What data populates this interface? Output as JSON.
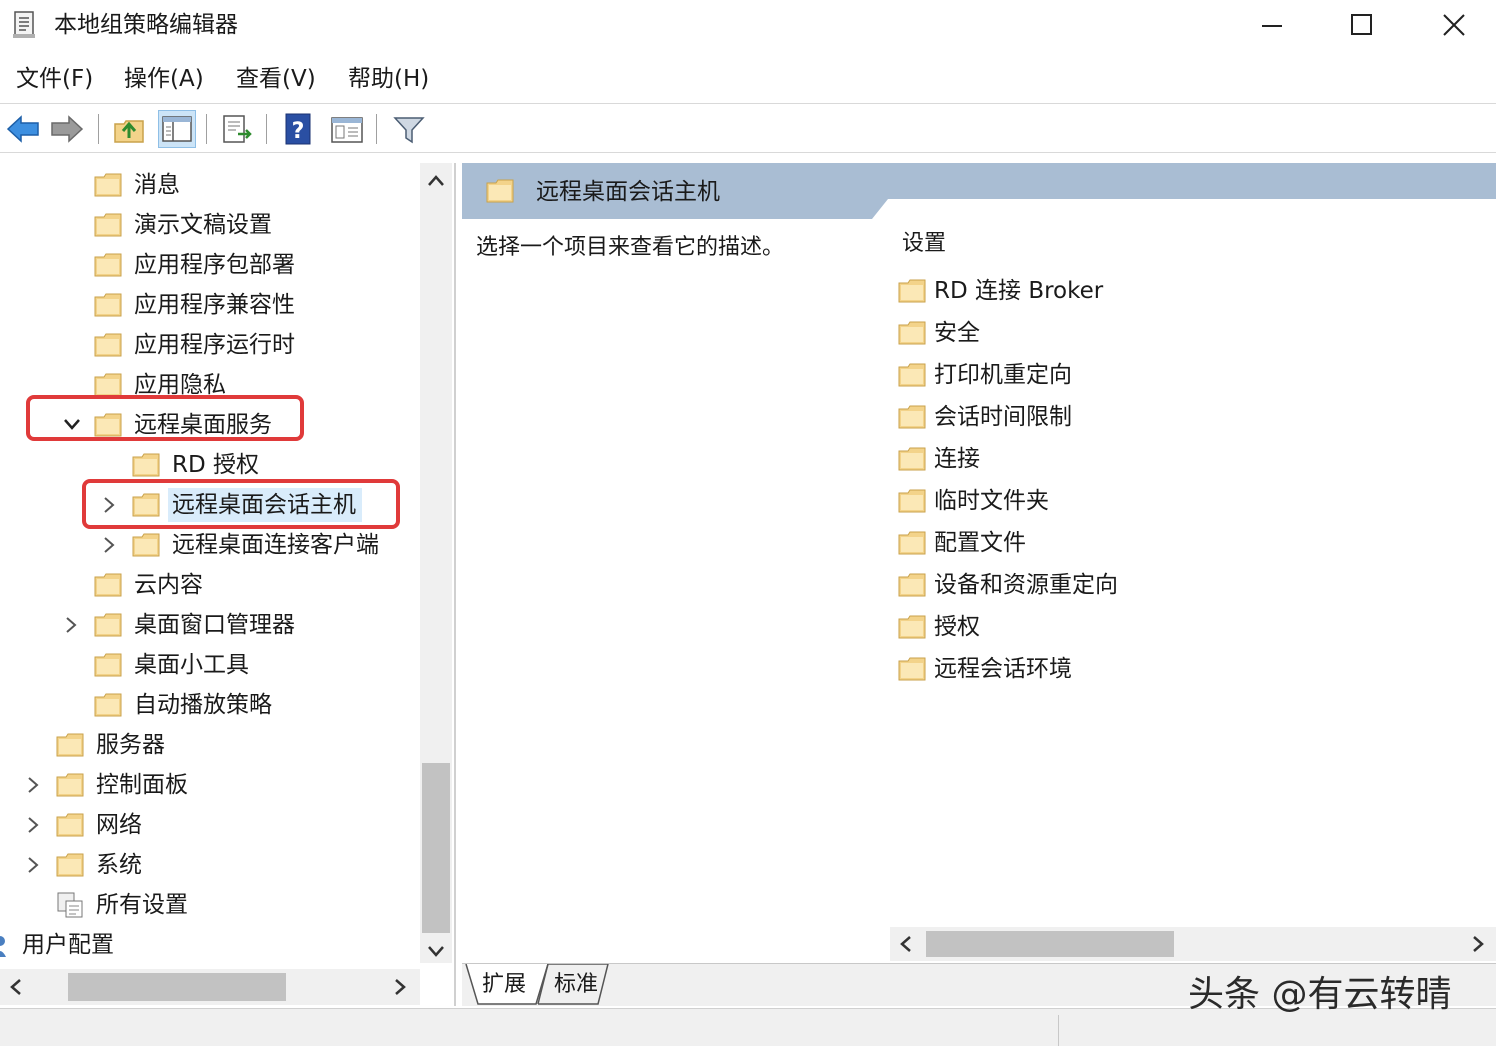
{
  "window": {
    "title": "本地组策略编辑器"
  },
  "menu": [
    "文件(F)",
    "操作(A)",
    "查看(V)",
    "帮助(H)"
  ],
  "colors": {
    "folder": "#f3d38a",
    "selection": "#d9ecfb",
    "highlight": "#e03a3a",
    "header": "#a9bdd3"
  },
  "tree": {
    "items": [
      {
        "label": "消息",
        "level": 2,
        "expander": "none"
      },
      {
        "label": "演示文稿设置",
        "level": 2,
        "expander": "none"
      },
      {
        "label": "应用程序包部署",
        "level": 2,
        "expander": "none"
      },
      {
        "label": "应用程序兼容性",
        "level": 2,
        "expander": "none"
      },
      {
        "label": "应用程序运行时",
        "level": 2,
        "expander": "none"
      },
      {
        "label": "应用隐私",
        "level": 2,
        "expander": "none"
      },
      {
        "label": "远程桌面服务",
        "level": 2,
        "expander": "expanded"
      },
      {
        "label": "RD 授权",
        "level": 3,
        "expander": "none"
      },
      {
        "label": "远程桌面会话主机",
        "level": 3,
        "expander": "collapsed",
        "selected": true
      },
      {
        "label": "远程桌面连接客户端",
        "level": 3,
        "expander": "collapsed"
      },
      {
        "label": "云内容",
        "level": 2,
        "expander": "none"
      },
      {
        "label": "桌面窗口管理器",
        "level": 2,
        "expander": "collapsed"
      },
      {
        "label": "桌面小工具",
        "level": 2,
        "expander": "none"
      },
      {
        "label": "自动播放策略",
        "level": 2,
        "expander": "none"
      },
      {
        "label": "服务器",
        "level": 1,
        "expander": "none"
      },
      {
        "label": "控制面板",
        "level": 1,
        "expander": "collapsed"
      },
      {
        "label": "网络",
        "level": 1,
        "expander": "collapsed"
      },
      {
        "label": "系统",
        "level": 1,
        "expander": "collapsed"
      },
      {
        "label": "所有设置",
        "level": 1,
        "expander": "none",
        "icon": "all-settings-icon"
      },
      {
        "label": "用户配置",
        "level": 0,
        "expander": "none",
        "icon": "user-config-icon"
      }
    ]
  },
  "right": {
    "title": "远程桌面会话主机",
    "description": "选择一个项目来查看它的描述。",
    "column_header": "设置",
    "settings": [
      "RD 连接 Broker",
      "安全",
      "打印机重定向",
      "会话时间限制",
      "连接",
      "临时文件夹",
      "配置文件",
      "设备和资源重定向",
      "授权",
      "远程会话环境"
    ]
  },
  "tabs": [
    "扩展",
    "标准"
  ],
  "watermark": "头条 @有云转晴"
}
